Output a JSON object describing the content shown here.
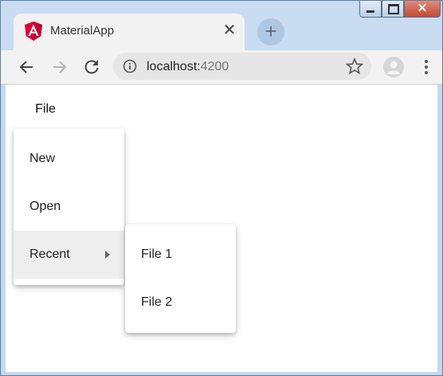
{
  "browser": {
    "tab_title": "MaterialApp",
    "tab_close_glyph": "✕",
    "new_tab_glyph": "+",
    "url_host": "localhost:",
    "url_port": "4200",
    "icons": [
      "angular-logo-icon",
      "back-arrow-icon",
      "forward-arrow-icon",
      "reload-icon",
      "info-icon",
      "star-icon",
      "profile-icon",
      "menu-kebab-icon"
    ]
  },
  "window_controls": {
    "close_glyph": "✕"
  },
  "app": {
    "file_button": "File",
    "menu_items": [
      "New",
      "Open",
      "Recent"
    ],
    "recent_submenu": [
      "File 1",
      "File 2"
    ]
  },
  "colors": {
    "angular_red": "#dd0031",
    "menu_active_bg": "#eeeeee"
  }
}
